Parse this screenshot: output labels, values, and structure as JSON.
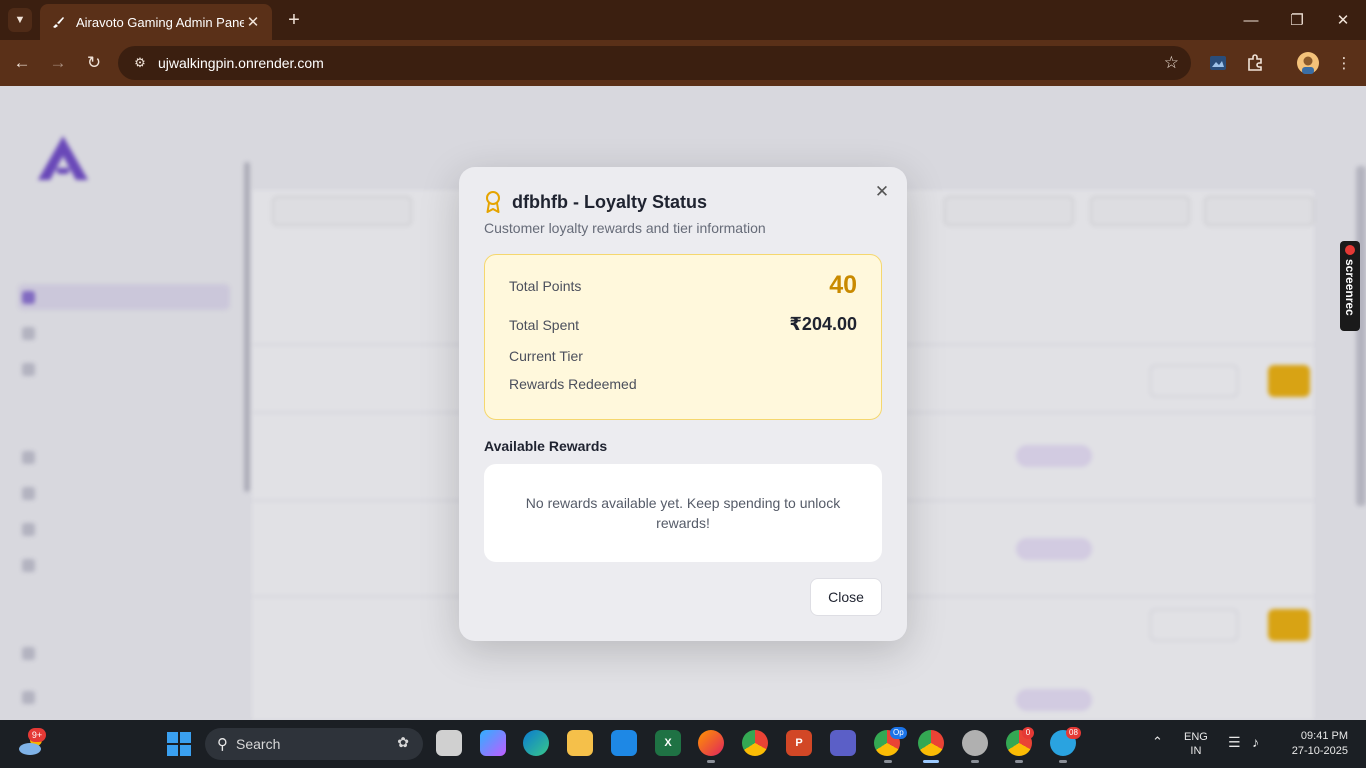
{
  "browser": {
    "tab_title": "Airavoto Gaming Admin Panel",
    "url": "ujwalkingpin.onrender.com"
  },
  "modal": {
    "title": "dfbhfb - Loyalty Status",
    "subtitle": "Customer loyalty rewards and tier information",
    "stats": {
      "total_points_label": "Total Points",
      "total_points_value": "40",
      "total_spent_label": "Total Spent",
      "total_spent_value": "₹204.00",
      "current_tier_label": "Current Tier",
      "rewards_redeemed_label": "Rewards Redeemed"
    },
    "rewards_heading": "Available Rewards",
    "rewards_empty": "No rewards available yet. Keep spending to unlock rewards!",
    "close_label": "Close",
    "accent_color": "#c98a00"
  },
  "screenrec": {
    "label": "screenrec"
  },
  "taskbar": {
    "search_placeholder": "Search",
    "weather_badge": "9+",
    "chrome_badge_1": "Op",
    "chrome_badge_2": "0",
    "telegram_badge": "08",
    "lang_line1": "ENG",
    "lang_line2": "IN",
    "time": "09:41 PM",
    "date": "27-10-2025"
  }
}
